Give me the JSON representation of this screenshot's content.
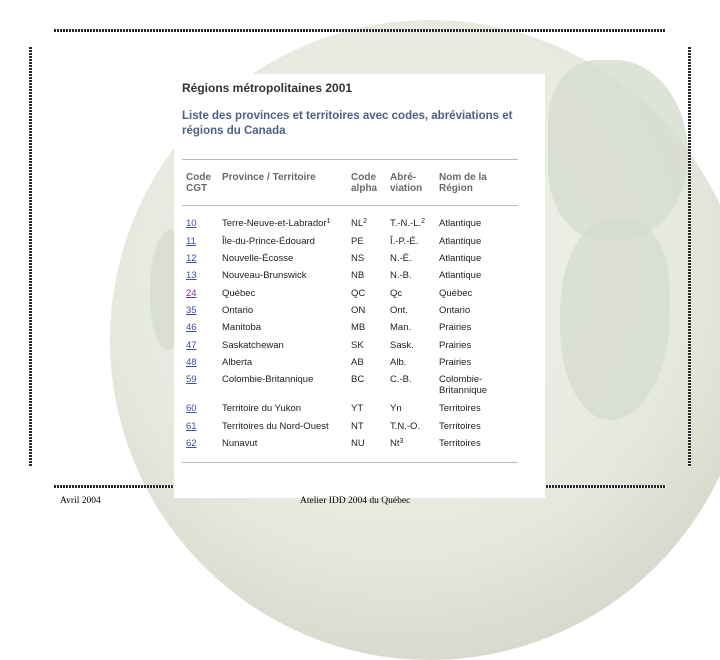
{
  "title": "Régions métropolitaines 2001",
  "subtitle": "Liste des provinces et territoires avec codes, abréviations et régions du Canada",
  "headers": {
    "code_cgt": [
      "Code",
      "CGT"
    ],
    "province": [
      "Province / Territoire"
    ],
    "code_alpha": [
      "Code",
      "alpha"
    ],
    "abreviation": [
      "Abré-",
      "viation"
    ],
    "region": [
      "Nom de la",
      "Région"
    ]
  },
  "rows": [
    {
      "code": "10",
      "name": "Terre-Neuve-et-Labrador",
      "name_sup": "1",
      "alpha": "NL",
      "alpha_sup": "2",
      "abbr": "T.-N.-L.",
      "abbr_sup": "2",
      "region": "Atlantique"
    },
    {
      "code": "11",
      "name": "Île-du-Prince-Édouard",
      "alpha": "PE",
      "abbr": "Î.-P.-É.",
      "region": "Atlantique"
    },
    {
      "code": "12",
      "name": "Nouvelle-Écosse",
      "alpha": "NS",
      "abbr": "N.-É.",
      "region": "Atlantique"
    },
    {
      "code": "13",
      "name": "Nouveau-Brunswick",
      "alpha": "NB",
      "abbr": "N.-B.",
      "region": "Atlantique"
    },
    {
      "code": "24",
      "name": "Québec",
      "alpha": "QC",
      "abbr": "Qc",
      "region": "Québec"
    },
    {
      "code": "35",
      "name": "Ontario",
      "alpha": "ON",
      "abbr": "Ont.",
      "region": "Ontario"
    },
    {
      "code": "46",
      "name": "Manitoba",
      "alpha": "MB",
      "abbr": "Man.",
      "region": "Prairies"
    },
    {
      "code": "47",
      "name": "Saskatchewan",
      "alpha": "SK",
      "abbr": "Sask.",
      "region": "Prairies"
    },
    {
      "code": "48",
      "name": "Alberta",
      "alpha": "AB",
      "abbr": "Alb.",
      "region": "Prairies"
    },
    {
      "code": "59",
      "name": "Colombie-Britannique",
      "alpha": "BC",
      "abbr": "C.-B.",
      "region": "Colombie-",
      "region2": "Britannique"
    },
    {
      "code": "60",
      "name": "Territoire du Yukon",
      "alpha": "YT",
      "abbr": "Yn",
      "region": "Territoires"
    },
    {
      "code": "61",
      "name": "Territoires du Nord-Ouest",
      "alpha": "NT",
      "abbr": "T.N.-O.",
      "region": "Territoires"
    },
    {
      "code": "62",
      "name": "Nunavut",
      "alpha": "NU",
      "abbr": "Nt",
      "abbr_sup": "3",
      "region": "Territoires"
    }
  ],
  "footer": {
    "left": "Avril 2004",
    "center": "Atelier IDD 2004 du Québec"
  },
  "colors": {
    "link": "#3a4fa8",
    "visited_link": "#7a2f8a",
    "subtitle": "#4e6085"
  }
}
